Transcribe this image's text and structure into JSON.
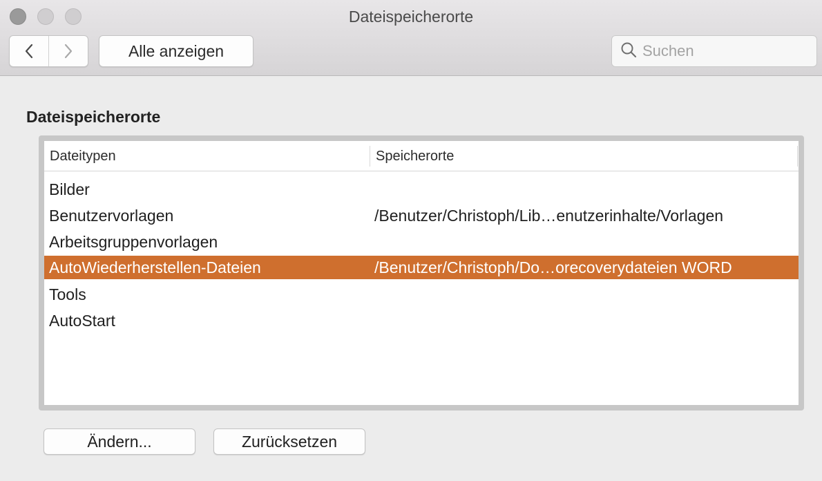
{
  "window": {
    "title": "Dateispeicherorte"
  },
  "toolbar": {
    "back_icon": "chevron-left-icon",
    "forward_icon": "chevron-right-icon",
    "show_all_label": "Alle anzeigen",
    "search": {
      "placeholder": "Suchen",
      "value": "",
      "icon": "magnifier-icon"
    }
  },
  "section": {
    "title": "Dateispeicherorte"
  },
  "table": {
    "columns": [
      "Dateitypen",
      "Speicherorte"
    ],
    "rows": [
      {
        "type": "Bilder",
        "location": ""
      },
      {
        "type": "Benutzervorlagen",
        "location": "/Benutzer/Christoph/Lib…enutzerinhalte/Vorlagen"
      },
      {
        "type": "Arbeitsgruppenvorlagen",
        "location": ""
      },
      {
        "type": "AutoWiederherstellen-Dateien",
        "location": "/Benutzer/Christoph/Do…orecoverydateien WORD",
        "selected": true
      },
      {
        "type": "Tools",
        "location": ""
      },
      {
        "type": "AutoStart",
        "location": ""
      }
    ],
    "selection_color": "#cf6f2e"
  },
  "buttons": {
    "change_label": "Ändern...",
    "reset_label": "Zurücksetzen"
  }
}
